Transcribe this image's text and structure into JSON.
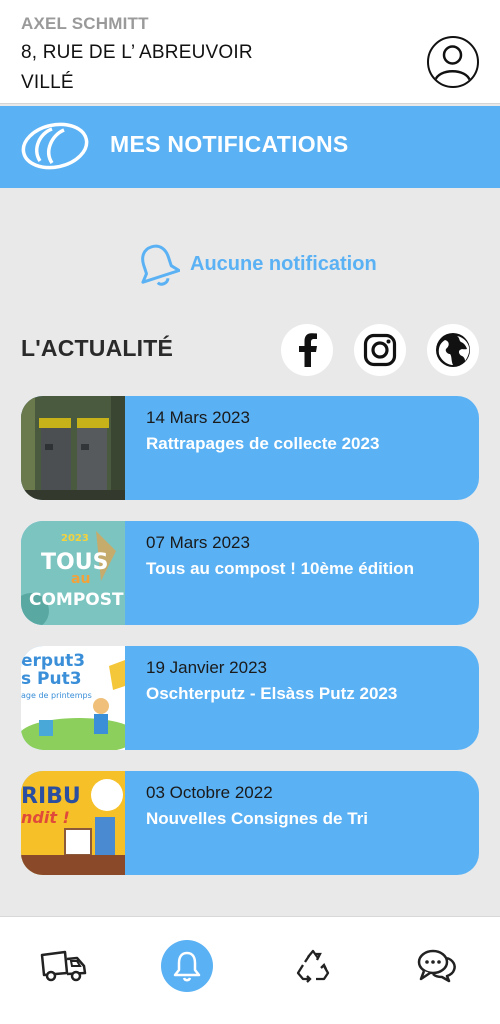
{
  "user": {
    "name": "AXEL SCHMITT",
    "address_line1": "8, RUE DE L’ ABREUVOIR",
    "address_line2": "VILLÉ"
  },
  "notifications": {
    "title": "MES NOTIFICATIONS",
    "empty_text": "Aucune notification"
  },
  "news": {
    "title": "L'ACTUALITÉ",
    "socials": [
      "facebook-icon",
      "instagram-icon",
      "globe-icon"
    ],
    "items": [
      {
        "date": "14 Mars 2023",
        "title": "Rattrapages de collecte 2023"
      },
      {
        "date": "07 Mars 2023",
        "title": "Tous au compost ! 10ème édition"
      },
      {
        "date": "19 Janvier 2023",
        "title": "Oschterputz - Elsàss Putz 2023"
      },
      {
        "date": "03 Octobre 2022",
        "title": "Nouvelles Consignes de Tri"
      }
    ],
    "thumb_texts": {
      "compost_year": "2023",
      "compost_line1": "TOUS",
      "compost_line2": "au",
      "compost_line3": "COMPOST",
      "putz_line1": "erput3",
      "putz_line2": "s Put3",
      "putz_line3": "age de printemps",
      "tri_line1": "RIBU",
      "tri_line2": "ndit !"
    }
  },
  "bottom_nav": [
    "truck-icon",
    "bell-icon",
    "recycle-icon",
    "chat-icon"
  ],
  "colors": {
    "accent": "#5ab1f4",
    "background": "#e9e9e9",
    "text_dark": "#2a2a2a"
  }
}
